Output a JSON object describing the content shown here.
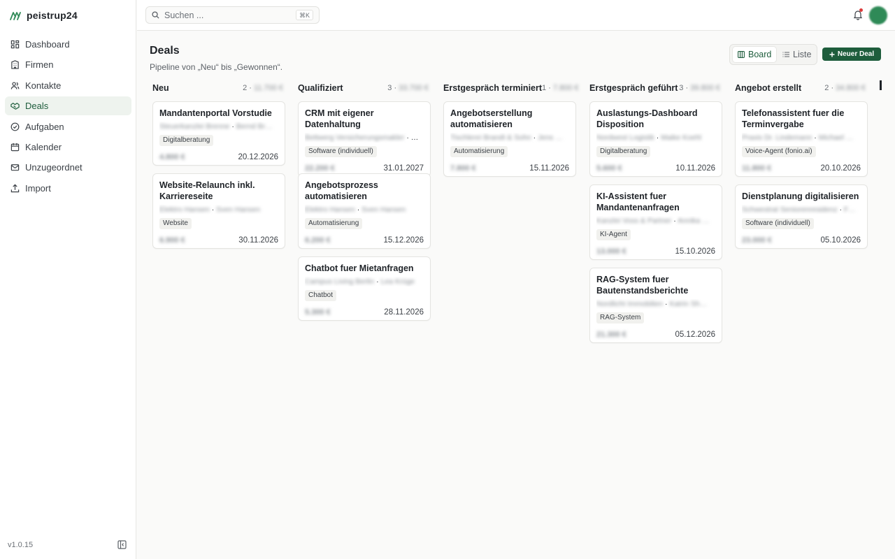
{
  "app": {
    "name": "peistrup24",
    "version": "v1.0.15"
  },
  "sidebar": {
    "items": [
      {
        "label": "Dashboard",
        "icon": "grid-icon",
        "active": false
      },
      {
        "label": "Firmen",
        "icon": "building-icon",
        "active": false
      },
      {
        "label": "Kontakte",
        "icon": "users-icon",
        "active": false
      },
      {
        "label": "Deals",
        "icon": "handshake-icon",
        "active": true
      },
      {
        "label": "Aufgaben",
        "icon": "check-circle-icon",
        "active": false
      },
      {
        "label": "Kalender",
        "icon": "calendar-icon",
        "active": false
      },
      {
        "label": "Unzugeordnet",
        "icon": "mail-icon",
        "active": false
      },
      {
        "label": "Import",
        "icon": "upload-icon",
        "active": false
      }
    ]
  },
  "topbar": {
    "search_placeholder": "Suchen ...",
    "shortcut": "⌘K"
  },
  "page": {
    "title": "Deals",
    "subtitle": "Pipeline von „Neu“ bis „Gewonnen“."
  },
  "view_toggle": {
    "board": "Board",
    "list": "Liste",
    "active": "board"
  },
  "actions": {
    "new_deal": "Neuer Deal"
  },
  "colors": {
    "accent": "#1e5d3c",
    "active_bg": "#eef3ee",
    "notification": "#dc3b3b"
  },
  "columns": [
    {
      "title": "Neu",
      "count": "2",
      "total": "11.700 €",
      "cards": [
        {
          "title": "Mandantenportal Vorstudie",
          "company": "Steuerkanzlei Brenne",
          "contact": "Bernd Br…",
          "tag": "Digitalberatung",
          "amount": "4.800 €",
          "date": "20.12.2026"
        },
        {
          "title": "Website-Relaunch inkl. Karriereseite",
          "company": "Elektro Hansen",
          "contact": "Sven Hansen",
          "tag": "Website",
          "amount": "6.900 €",
          "date": "30.11.2026"
        }
      ]
    },
    {
      "title": "Qualifiziert",
      "count": "3",
      "total": "33.700 €",
      "cards": [
        {
          "title": "CRM mit eigener Datenhaltung",
          "company": "Bettwerg Versicherungsmakler",
          "contact": "…",
          "tag": "Software (individuell)",
          "amount": "22.200 €",
          "date": "31.01.2027"
        },
        {
          "title": "Angebotsprozess automatisieren",
          "company": "Elektro Hansen",
          "contact": "Sven Hansen",
          "tag": "Automatisierung",
          "amount": "6.200 €",
          "date": "15.12.2026"
        },
        {
          "title": "Chatbot fuer Mietanfragen",
          "company": "Campus Living Berlin",
          "contact": "Lea Krüge",
          "tag": "Chatbot",
          "amount": "5.300 €",
          "date": "28.11.2026"
        }
      ]
    },
    {
      "title": "Erstgespräch terminiert",
      "count": "1",
      "total": "7.800 €",
      "cards": [
        {
          "title": "Angebotserstellung automatisieren",
          "company": "Tischlerei Brandt & Sohn",
          "contact": "Jens …",
          "tag": "Automatisierung",
          "amount": "7.800 €",
          "date": "15.11.2026"
        }
      ]
    },
    {
      "title": "Erstgespräch geführt",
      "count": "3",
      "total": "39.800 €",
      "cards": [
        {
          "title": "Auslastungs-Dashboard Disposition",
          "company": "Nordwest Logistik",
          "contact": "Maike Koehl",
          "tag": "Digitalberatung",
          "amount": "5.600 €",
          "date": "10.11.2026"
        },
        {
          "title": "KI-Assistent fuer Mandantenanfragen",
          "company": "Kanzlei Voss & Partner",
          "contact": "Annika …",
          "tag": "KI-Agent",
          "amount": "13.000 €",
          "date": "15.10.2026"
        },
        {
          "title": "RAG-System fuer Bautenstandsberichte",
          "company": "Nordlicht Immobilien",
          "contact": "Katrin Sh…",
          "tag": "RAG-System",
          "amount": "21.300 €",
          "date": "05.12.2026"
        }
      ]
    },
    {
      "title": "Angebot erstellt",
      "count": "2",
      "total": "34.800 €",
      "cards": [
        {
          "title": "Telefonassistent fuer die Terminvergabe",
          "company": "Praxis Dr. Lindemann",
          "contact": "Michael …",
          "tag": "Voice-Agent (fonio.ai)",
          "amount": "11.800 €",
          "date": "20.10.2026"
        },
        {
          "title": "Dienstplanung digitalisieren",
          "company": "Schwestrat Seniorenresidenz",
          "contact": "F…",
          "tag": "Software (individuell)",
          "amount": "23.000 €",
          "date": "05.10.2026"
        }
      ]
    }
  ]
}
